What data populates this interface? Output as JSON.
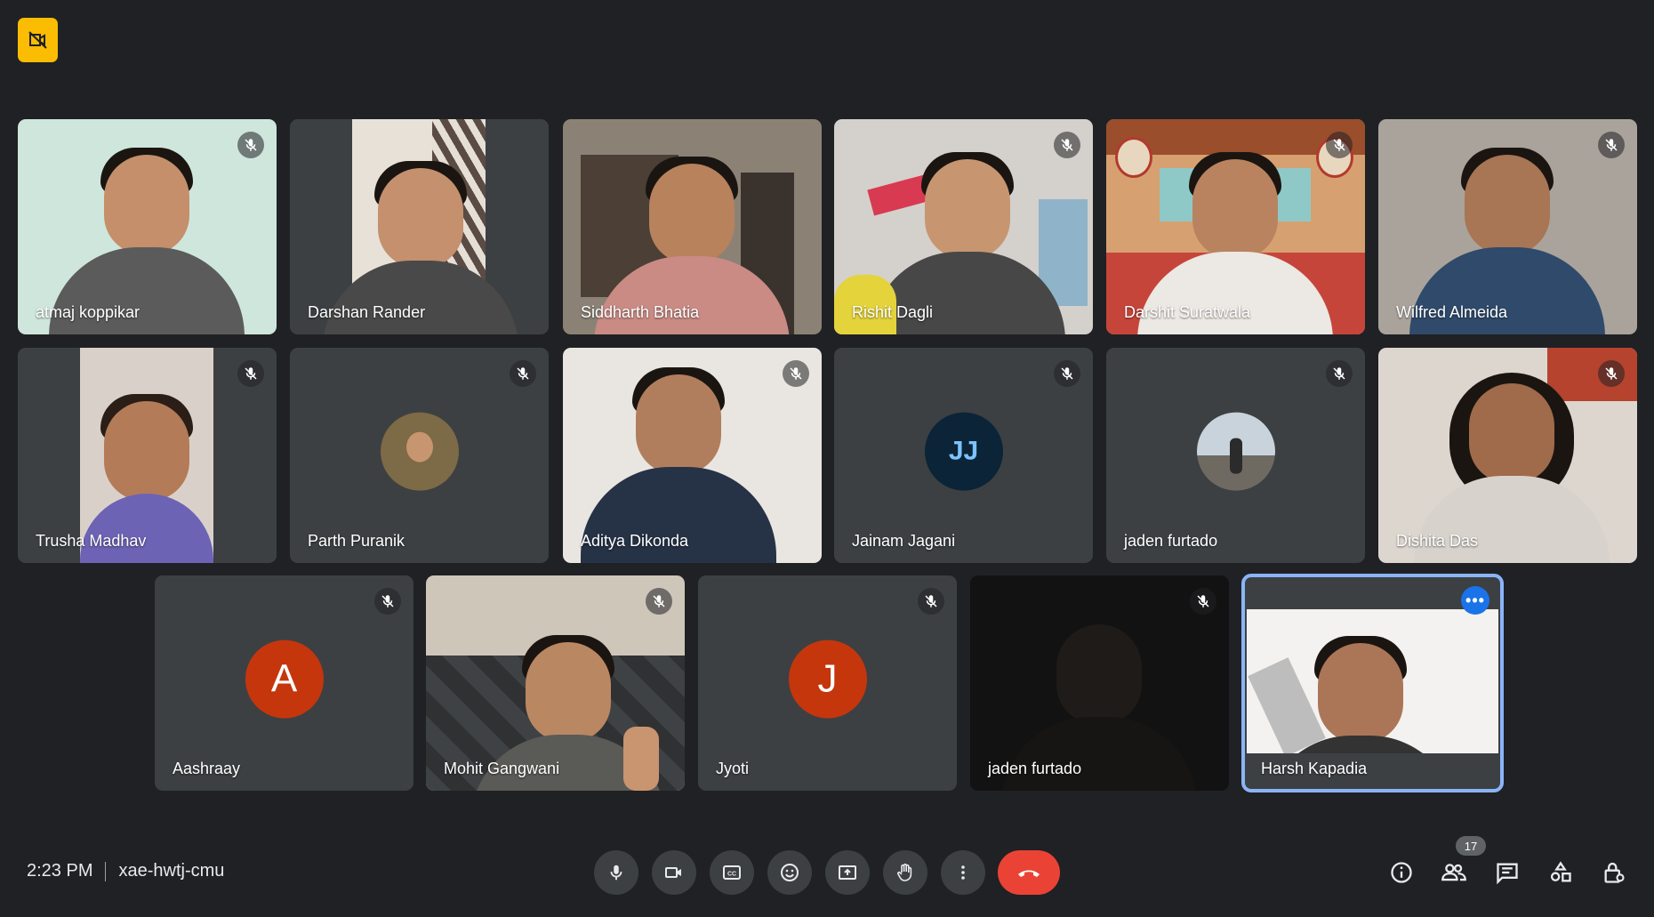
{
  "window": {
    "badge_icon": "video-off-icon",
    "badge_color": "#fbbc04"
  },
  "participants": [
    {
      "name": "atmaj koppikar",
      "muted": true,
      "type": "video"
    },
    {
      "name": "Darshan Rander",
      "muted": false,
      "type": "video"
    },
    {
      "name": "Siddharth Bhatia",
      "muted": false,
      "type": "video"
    },
    {
      "name": "Rishit Dagli",
      "muted": true,
      "type": "video"
    },
    {
      "name": "Darshit Suratwala",
      "muted": true,
      "type": "video"
    },
    {
      "name": "Wilfred Almeida",
      "muted": true,
      "type": "video"
    },
    {
      "name": "Trusha Madhav",
      "muted": true,
      "type": "video"
    },
    {
      "name": "Parth Puranik",
      "muted": true,
      "type": "avatar-photo"
    },
    {
      "name": "Aditya Dikonda",
      "muted": true,
      "type": "video"
    },
    {
      "name": "Jainam Jagani",
      "muted": true,
      "type": "avatar-photo",
      "avatar_text": "JJ"
    },
    {
      "name": "jaden furtado",
      "muted": true,
      "type": "avatar-photo"
    },
    {
      "name": "Dishita Das",
      "muted": true,
      "type": "video"
    },
    {
      "name": "Aashraay",
      "muted": true,
      "type": "avatar-letter",
      "avatar_letter": "A"
    },
    {
      "name": "Mohit Gangwani",
      "muted": true,
      "type": "video"
    },
    {
      "name": "Jyoti",
      "muted": true,
      "type": "avatar-letter",
      "avatar_letter": "J"
    },
    {
      "name": "jaden furtado",
      "muted": true,
      "type": "video"
    },
    {
      "name": "Harsh Kapadia",
      "muted": false,
      "type": "video",
      "self": true
    }
  ],
  "footer": {
    "time": "2:23 PM",
    "meeting_code": "xae-hwtj-cmu",
    "participant_count": "17"
  },
  "controls": [
    {
      "name": "microphone",
      "icon": "mic-icon"
    },
    {
      "name": "camera",
      "icon": "camera-icon"
    },
    {
      "name": "captions",
      "icon": "captions-icon"
    },
    {
      "name": "reactions",
      "icon": "emoji-icon"
    },
    {
      "name": "present",
      "icon": "present-screen-icon"
    },
    {
      "name": "raise-hand",
      "icon": "hand-icon"
    },
    {
      "name": "more-options",
      "icon": "more-vert-icon"
    },
    {
      "name": "leave-call",
      "icon": "end-call-icon",
      "color": "#ea4335"
    }
  ],
  "right_controls": [
    {
      "name": "meeting-details",
      "icon": "info-icon"
    },
    {
      "name": "people",
      "icon": "people-icon"
    },
    {
      "name": "chat",
      "icon": "chat-icon"
    },
    {
      "name": "activities",
      "icon": "activities-icon"
    },
    {
      "name": "host-controls",
      "icon": "lock-person-icon"
    }
  ],
  "colors": {
    "background": "#202124",
    "tile": "#3c4043",
    "accent": "#8ab4f8",
    "avatar_orange": "#c5360d"
  }
}
